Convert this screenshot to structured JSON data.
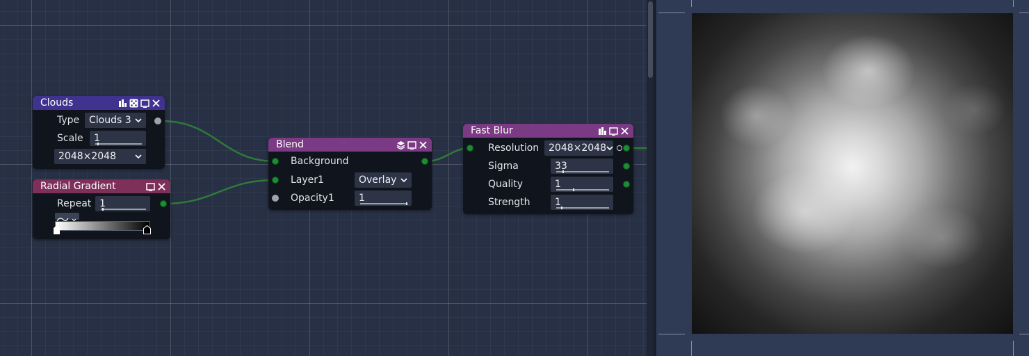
{
  "colors": {
    "clouds_header": "#3f338f",
    "gradient_header": "#7e2f5a",
    "blend_header": "#7b3a84",
    "fastblur_header": "#7b3a84",
    "wire": "#2e7a3a",
    "port_green": "#1e8c34"
  },
  "nodes": {
    "clouds": {
      "title": "Clouds",
      "header_icons": [
        "bar-chart-icon",
        "dice-icon",
        "window-icon",
        "close-icon"
      ],
      "type_label": "Type",
      "type_value": "Clouds 3",
      "scale_label": "Scale",
      "scale_value": "1",
      "scale_fraction": 0.05,
      "resolution_value": "2048×2048"
    },
    "radial_gradient": {
      "title": "Radial Gradient",
      "header_icons": [
        "window-icon",
        "close-icon"
      ],
      "repeat_label": "Repeat",
      "repeat_value": "1",
      "repeat_fraction": 0.03,
      "ramp_colors": [
        "#ffffff",
        "#000000"
      ],
      "interpolation_icon": "curve-icon"
    },
    "blend": {
      "title": "Blend",
      "header_icons": [
        "layers-icon",
        "window-icon",
        "close-icon"
      ],
      "background_label": "Background",
      "layer1_label": "Layer1",
      "layer1_mode": "Overlay",
      "opacity_label": "Opacity1",
      "opacity_value": "1",
      "opacity_fraction": 1.0
    },
    "fast_blur": {
      "title": "Fast Blur",
      "header_icons": [
        "bar-chart-icon",
        "window-icon",
        "close-icon"
      ],
      "resolution_label": "Resolution",
      "resolution_value": "2048×2048",
      "sigma_label": "Sigma",
      "sigma_value": "33",
      "sigma_fraction": 0.12,
      "quality_label": "Quality",
      "quality_value": "1",
      "quality_fraction": 0.33,
      "strength_label": "Strength",
      "strength_value": "1",
      "strength_fraction": 0.1
    }
  },
  "preview": {
    "image_icon": "cloud-texture-preview"
  }
}
